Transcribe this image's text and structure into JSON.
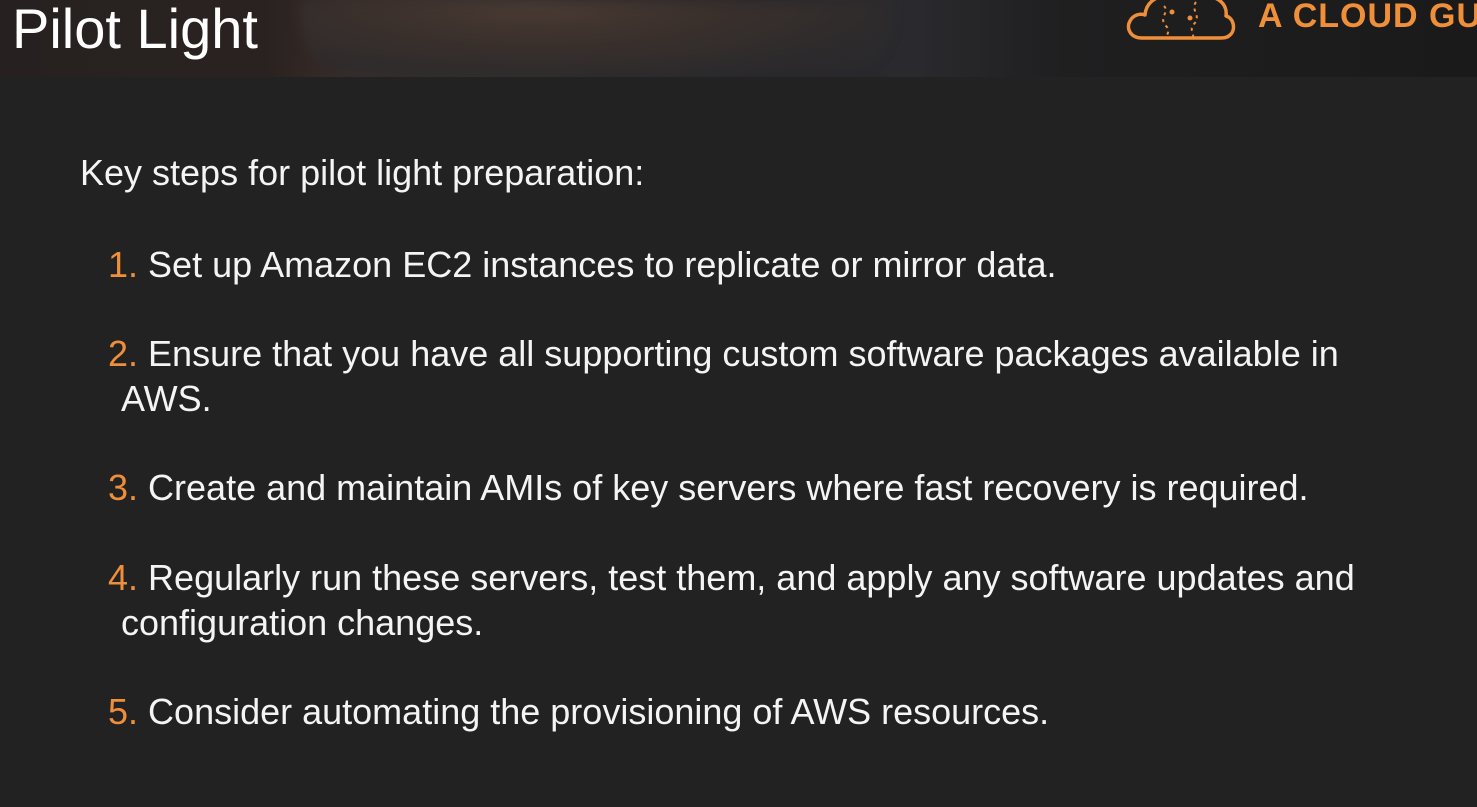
{
  "header": {
    "title": "Pilot Light",
    "brand_text": "A CLOUD GU",
    "brand_color": "#f08f3a"
  },
  "content": {
    "intro": "Key steps for pilot light preparation:",
    "steps": [
      {
        "number": "1.",
        "line1": "Set up Amazon EC2 instances to replicate or mirror data.",
        "line2": ""
      },
      {
        "number": "2.",
        "line1": "Ensure that you have all supporting custom software packages available in",
        "line2": "AWS."
      },
      {
        "number": "3.",
        "line1": "Create and maintain AMIs of key servers where fast recovery is required.",
        "line2": ""
      },
      {
        "number": "4.",
        "line1": "Regularly run these servers, test them, and apply any software updates and",
        "line2": "configuration changes."
      },
      {
        "number": "5.",
        "line1": "Consider automating the provisioning of AWS resources.",
        "line2": ""
      }
    ]
  },
  "icons": {
    "brand_logo": "cloud-icon"
  },
  "colors": {
    "background": "#222222",
    "text": "#f4f4f4",
    "accent": "#f08f3a"
  }
}
